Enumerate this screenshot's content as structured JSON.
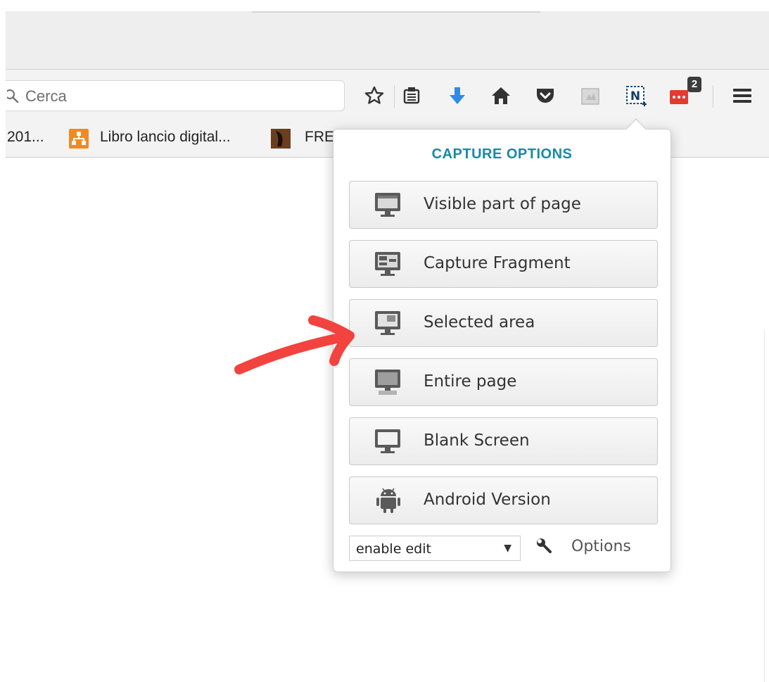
{
  "search": {
    "placeholder": "Cerca"
  },
  "toolbar": {
    "icons": [
      "star-icon",
      "reading-list-icon",
      "download-icon",
      "home-icon",
      "pocket-icon",
      "extension-icon",
      "capture-extension-icon",
      "notification-extension-icon",
      "menu-icon"
    ],
    "badge_count": "2",
    "colors": {
      "download": "#2e8be8",
      "notification": "#e33b2e"
    }
  },
  "bookmarks": {
    "items": [
      {
        "label": "201..."
      },
      {
        "label": "Libro lancio digital..."
      },
      {
        "label": "FRE"
      }
    ]
  },
  "popup": {
    "title": "CAPTURE OPTIONS",
    "title_color": "#178aa3",
    "options": [
      {
        "label": "Visible part of page",
        "icon": "monitor-visible-icon"
      },
      {
        "label": "Capture Fragment",
        "icon": "monitor-fragment-icon"
      },
      {
        "label": "Selected area",
        "icon": "monitor-selected-icon"
      },
      {
        "label": "Entire page",
        "icon": "monitor-entire-icon"
      },
      {
        "label": "Blank Screen",
        "icon": "monitor-blank-icon"
      },
      {
        "label": "Android Version",
        "icon": "android-icon"
      }
    ],
    "select_value": "enable edit",
    "options_link": "Options"
  },
  "annotation": {
    "arrow_color": "#f2433f"
  }
}
